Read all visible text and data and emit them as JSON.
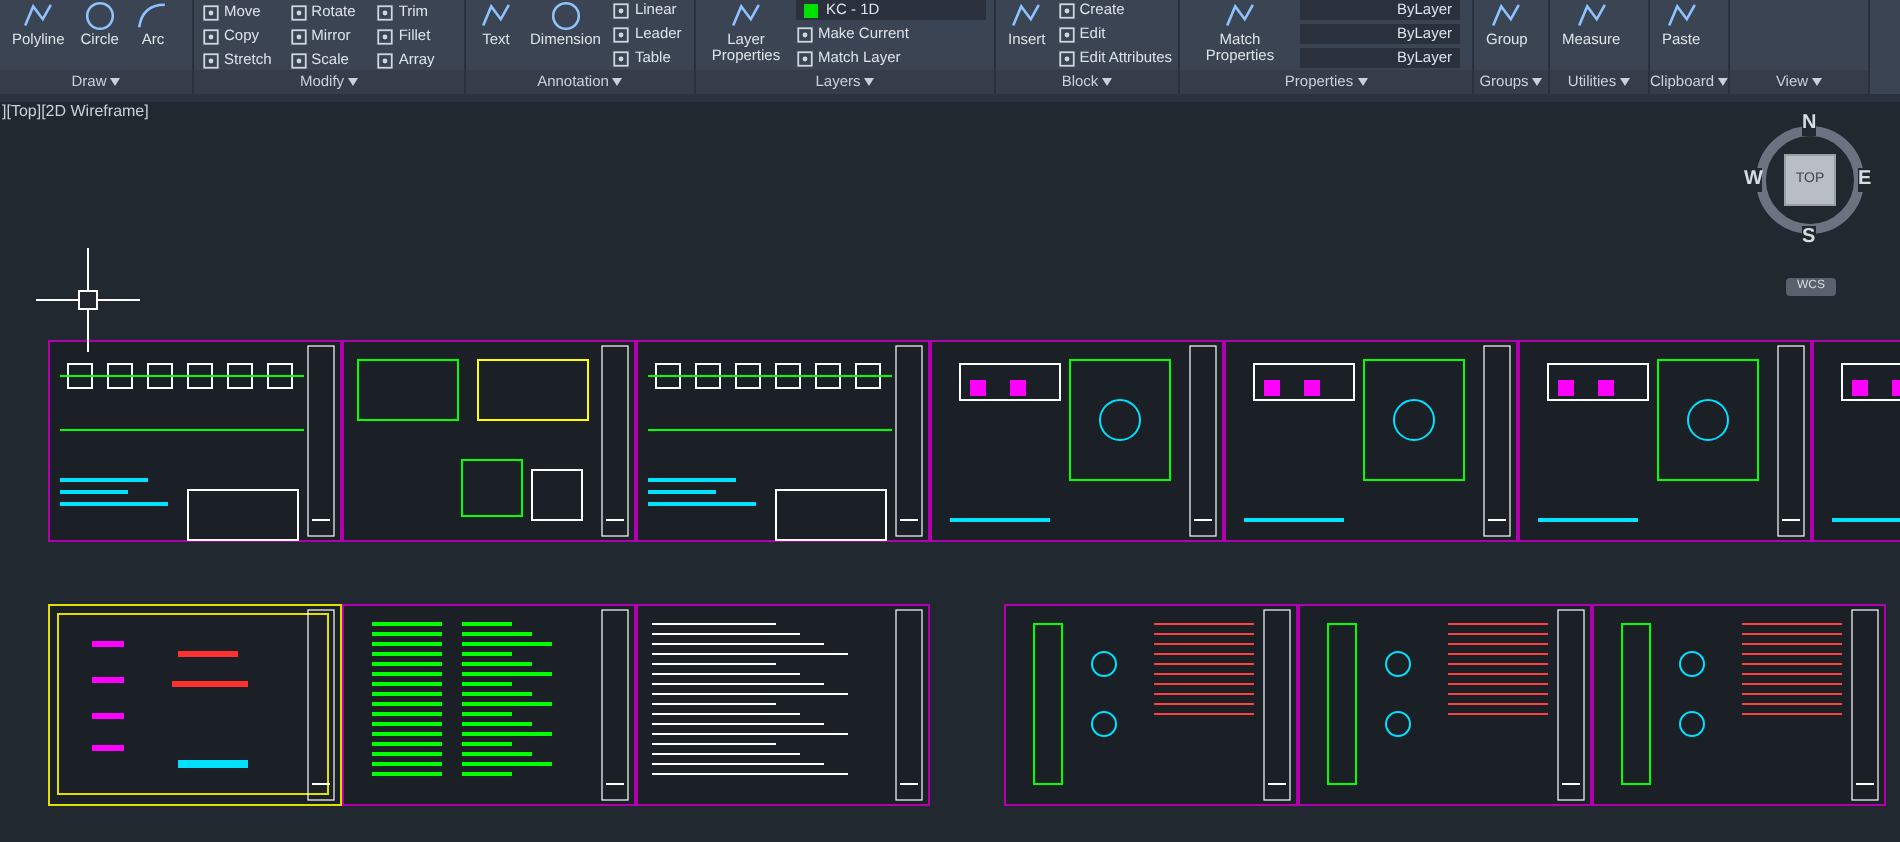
{
  "ribbon": {
    "panels": [
      {
        "title": "Draw",
        "kind": "draw",
        "large": [
          "Polyline",
          "Circle",
          "Arc"
        ]
      },
      {
        "title": "Modify",
        "kind": "modify",
        "tools": [
          "Move",
          "Rotate",
          "Trim",
          "Copy",
          "Mirror",
          "Fillet",
          "Stretch",
          "Scale",
          "Array"
        ]
      },
      {
        "title": "Annotation",
        "kind": "annotation",
        "large": [
          "Text",
          "Dimension"
        ],
        "tools": [
          "Linear",
          "Leader",
          "Table"
        ]
      },
      {
        "title": "Layers",
        "kind": "layers",
        "large": [
          "Layer Properties"
        ],
        "layer": "KC - 1D",
        "tools": [
          "Make Current",
          "Match Layer"
        ]
      },
      {
        "title": "Block",
        "kind": "block",
        "large": [
          "Insert"
        ],
        "tools": [
          "Create",
          "Edit",
          "Edit Attributes"
        ]
      },
      {
        "title": "Properties",
        "kind": "properties",
        "large": [
          "Match Properties"
        ],
        "dropdowns": [
          "ByLayer",
          "ByLayer",
          "ByLayer"
        ]
      },
      {
        "title": "Groups",
        "kind": "groups",
        "large": [
          "Group"
        ]
      },
      {
        "title": "Utilities",
        "kind": "utilities",
        "large": [
          "Measure"
        ]
      },
      {
        "title": "Clipboard",
        "kind": "clipboard",
        "large": [
          "Paste"
        ]
      },
      {
        "title": "View",
        "kind": "view"
      }
    ]
  },
  "viewport": {
    "label": "][Top][2D Wireframe]"
  },
  "viewcube": {
    "north": "N",
    "south": "S",
    "east": "E",
    "west": "W",
    "face": "TOP",
    "ucs": "WCS"
  },
  "canvas": {
    "rows": [
      {
        "groups": [
          [
            {
              "kind": "plan"
            },
            {
              "kind": "detail"
            },
            {
              "kind": "plan"
            },
            {
              "kind": "section"
            },
            {
              "kind": "section"
            },
            {
              "kind": "section"
            },
            {
              "kind": "section"
            }
          ]
        ]
      },
      {
        "groups": [
          [
            {
              "kind": "cover"
            },
            {
              "kind": "table"
            },
            {
              "kind": "notes"
            }
          ],
          [
            {
              "kind": "column"
            },
            {
              "kind": "column"
            },
            {
              "kind": "column"
            }
          ]
        ]
      }
    ]
  }
}
